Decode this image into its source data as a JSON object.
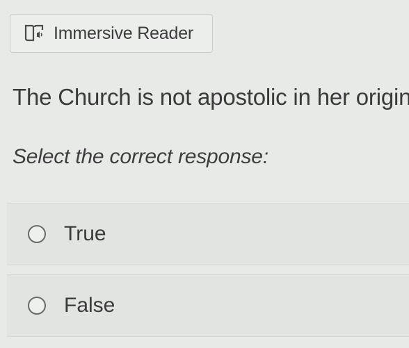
{
  "toolbar": {
    "immersive_reader_label": "Immersive Reader",
    "immersive_reader_icon": "immersive-reader-icon"
  },
  "question": {
    "text": "The Church is not apostolic in her origin.",
    "prompt": "Select the correct response:"
  },
  "options": [
    {
      "label": "True",
      "selected": false
    },
    {
      "label": "False",
      "selected": false
    }
  ],
  "colors": {
    "background": "#e8eae8",
    "text": "#3a3a3a",
    "radio_border": "#6a6a6a"
  }
}
